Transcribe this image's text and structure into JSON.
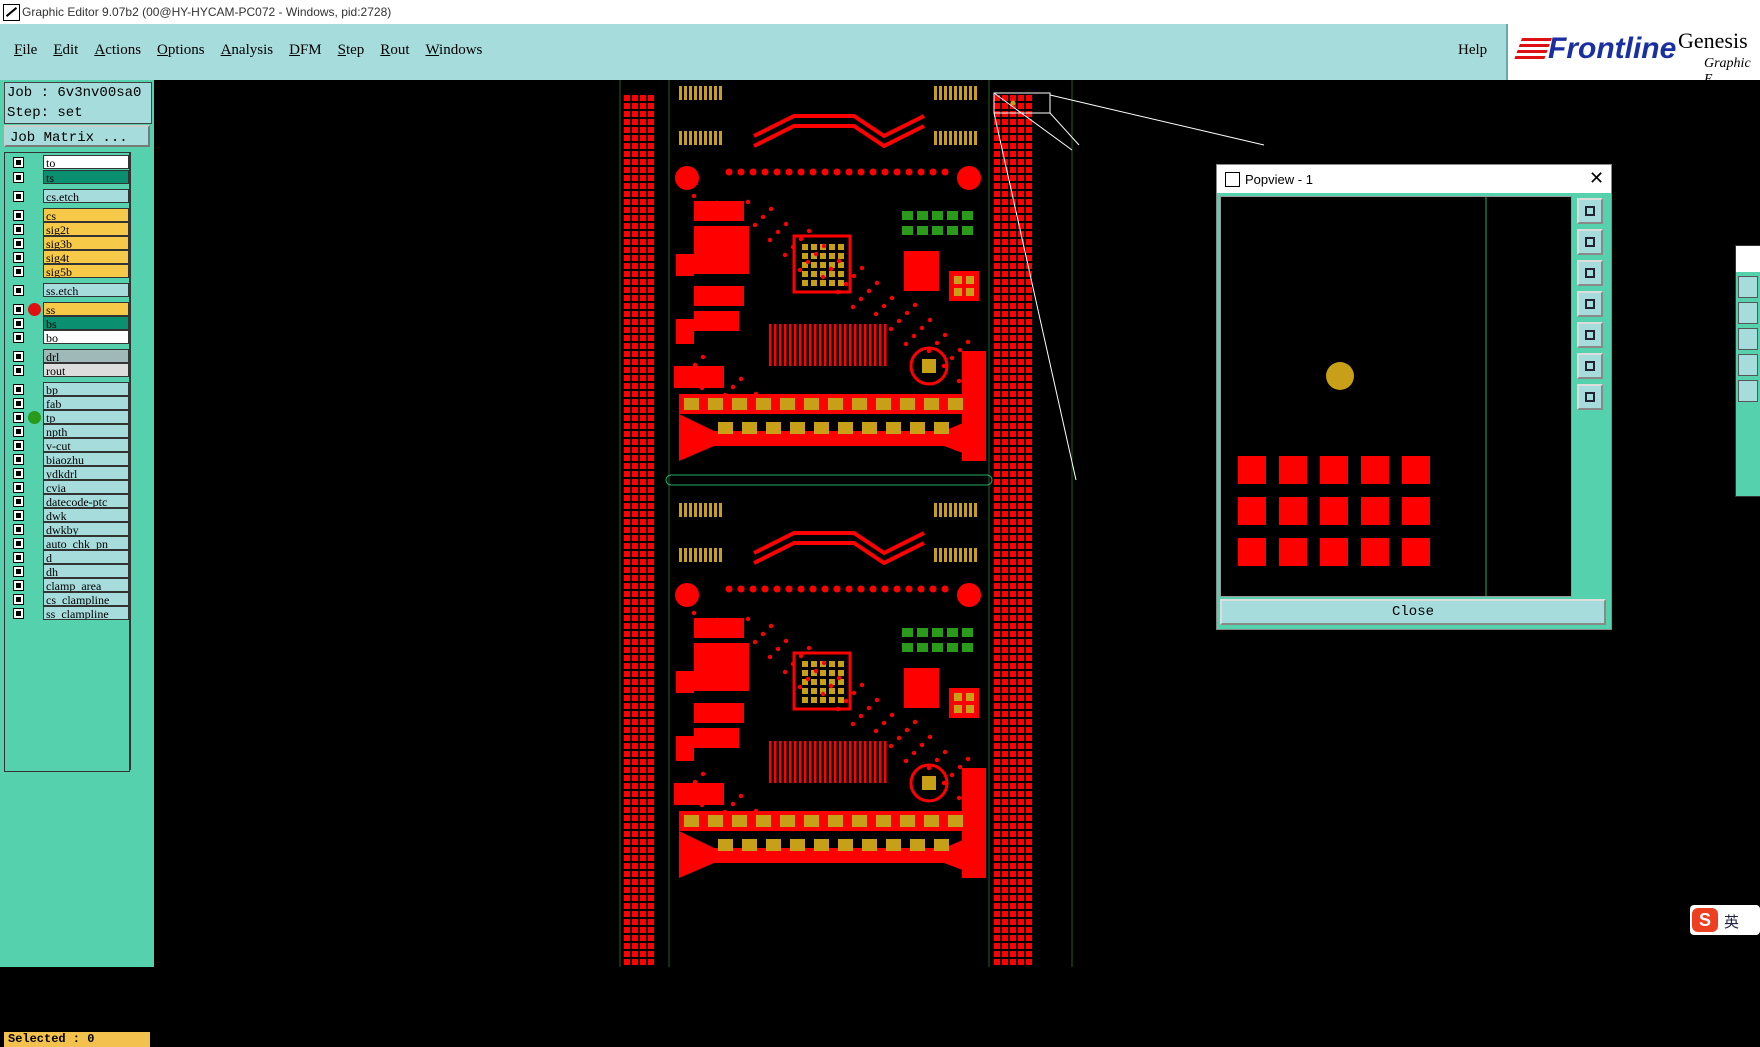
{
  "window": {
    "title": "Graphic Editor 9.07b2 (00@HY-HYCAM-PC072 - Windows, pid:2728)"
  },
  "menu": {
    "items": [
      {
        "underline": "F",
        "rest": "ile"
      },
      {
        "underline": "E",
        "rest": "dit"
      },
      {
        "underline": "A",
        "rest": "ctions"
      },
      {
        "underline": "O",
        "rest": "ptions"
      },
      {
        "underline": "A",
        "rest": "nalysis"
      },
      {
        "underline": "D",
        "rest": "FM"
      },
      {
        "underline": "S",
        "rest": "tep"
      },
      {
        "underline": "R",
        "rest": "out"
      },
      {
        "underline": "W",
        "rest": "indows"
      }
    ],
    "help": "Help"
  },
  "logo": {
    "brand": "Frontline",
    "product": "Genesis",
    "subtitle": "Graphic E"
  },
  "job": {
    "job_line": "Job : 6v3nv00sa0",
    "step_line": "Step: set",
    "matrix_button": "Job Matrix ..."
  },
  "layers": [
    {
      "name": "to",
      "color": "#ffffff",
      "dot": ""
    },
    {
      "name": "ts",
      "color": "#0a9070",
      "dot": ""
    },
    {
      "name": "cs.etch",
      "color": "#a6dcdc",
      "dot": ""
    },
    {
      "name": "cs",
      "color": "#f7c948",
      "dot": ""
    },
    {
      "name": "sig2t",
      "color": "#f7c948",
      "dot": ""
    },
    {
      "name": "sig3b",
      "color": "#f7c948",
      "dot": ""
    },
    {
      "name": "sig4t",
      "color": "#f7c948",
      "dot": ""
    },
    {
      "name": "sig5b",
      "color": "#f7c948",
      "dot": ""
    },
    {
      "name": "ss.etch",
      "color": "#a6dcdc",
      "dot": ""
    },
    {
      "name": "ss",
      "color": "#f7c948",
      "dot": "#e01010"
    },
    {
      "name": "bs",
      "color": "#0a9070",
      "dot": ""
    },
    {
      "name": "bo",
      "color": "#ffffff",
      "dot": ""
    },
    {
      "name": "drl",
      "color": "#9fb8b8",
      "dot": ""
    },
    {
      "name": "rout",
      "color": "#dddddd",
      "dot": ""
    },
    {
      "name": "bp",
      "color": "#a6dcdc",
      "dot": ""
    },
    {
      "name": "fab",
      "color": "#a6dcdc",
      "dot": ""
    },
    {
      "name": "tp",
      "color": "#a6dcdc",
      "dot": "#2a9a1a"
    },
    {
      "name": "npth",
      "color": "#a6dcdc",
      "dot": ""
    },
    {
      "name": "v-cut",
      "color": "#a6dcdc",
      "dot": ""
    },
    {
      "name": "biaozhu",
      "color": "#a6dcdc",
      "dot": ""
    },
    {
      "name": "ydkdrl",
      "color": "#a6dcdc",
      "dot": ""
    },
    {
      "name": "cvia",
      "color": "#a6dcdc",
      "dot": ""
    },
    {
      "name": "datecode-ptc",
      "color": "#a6dcdc",
      "dot": ""
    },
    {
      "name": "dwk",
      "color": "#a6dcdc",
      "dot": ""
    },
    {
      "name": "dwkby",
      "color": "#a6dcdc",
      "dot": ""
    },
    {
      "name": "auto_chk_pn",
      "color": "#a6dcdc",
      "dot": ""
    },
    {
      "name": "d",
      "color": "#a6dcdc",
      "dot": ""
    },
    {
      "name": "dh",
      "color": "#a6dcdc",
      "dot": ""
    },
    {
      "name": "clamp_area",
      "color": "#a6dcdc",
      "dot": ""
    },
    {
      "name": "cs_clampline",
      "color": "#a6dcdc",
      "dot": ""
    },
    {
      "name": "ss_clampline",
      "color": "#a6dcdc",
      "dot": ""
    }
  ],
  "status": {
    "selected": "Selected : 0"
  },
  "popview": {
    "title": "Popview - 1",
    "close_button": "Close"
  },
  "ime": {
    "glyph": "S",
    "lang": "英"
  },
  "colors": {
    "panel": "#56d1ad",
    "menubar": "#a6dcdc",
    "copper": "#ff0000",
    "pad": "#c8a018",
    "green": "#2a9a1a"
  }
}
